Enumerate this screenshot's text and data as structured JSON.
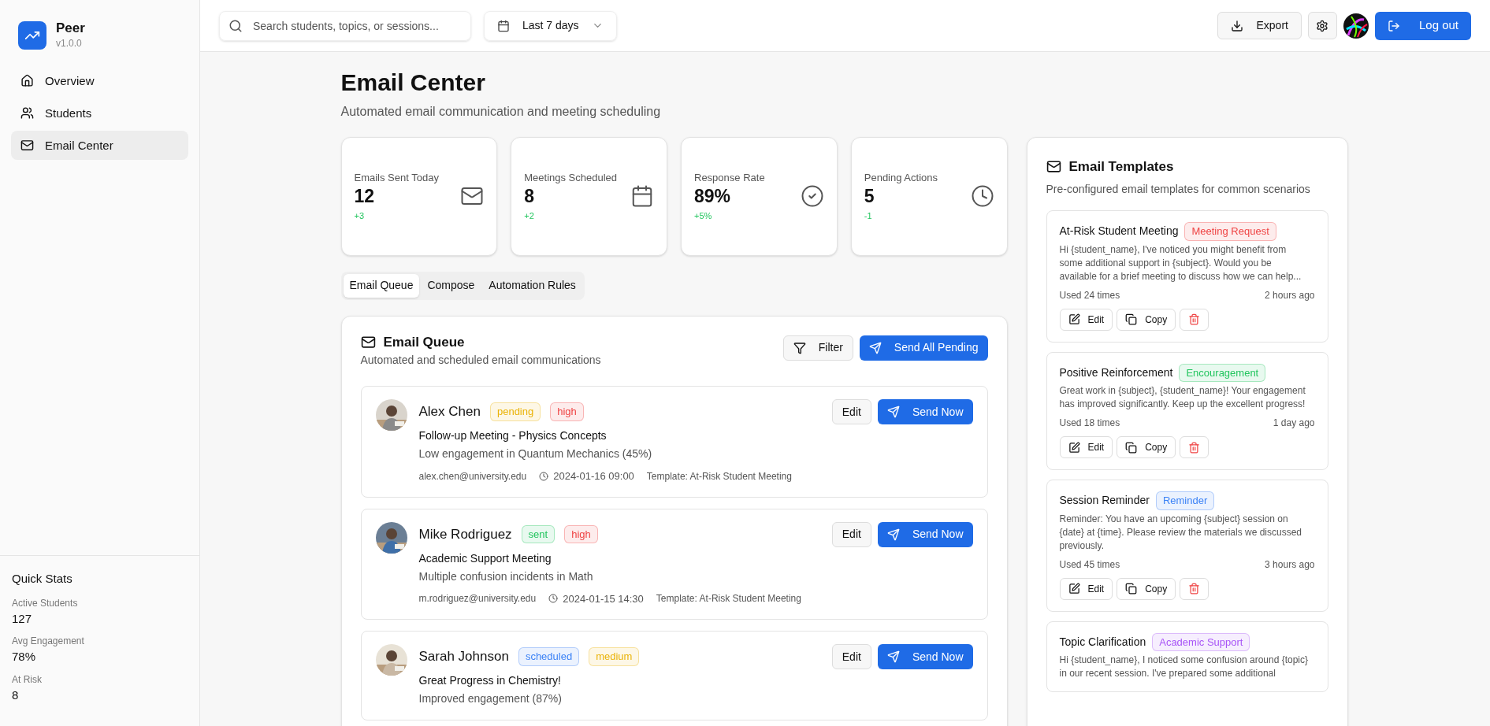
{
  "app": {
    "name": "Peer",
    "version": "v1.0.0"
  },
  "nav": [
    {
      "label": "Overview",
      "selected": false
    },
    {
      "label": "Students",
      "selected": false
    },
    {
      "label": "Email Center",
      "selected": true
    }
  ],
  "quick_stats": {
    "title": "Quick Stats",
    "items": [
      {
        "label": "Active Students",
        "value": "127"
      },
      {
        "label": "Avg Engagement",
        "value": "78%"
      },
      {
        "label": "At Risk",
        "value": "8"
      }
    ]
  },
  "header": {
    "search": {
      "placeholder": "Search students, topics, or sessions..."
    },
    "range": "Last 7 days",
    "export": "Export",
    "logout": "Log out"
  },
  "page": {
    "title": "Email Center",
    "subtitle": "Automated email communication and meeting scheduling"
  },
  "stats": [
    {
      "label": "Emails Sent Today",
      "value": "12",
      "change": "+3"
    },
    {
      "label": "Meetings Scheduled",
      "value": "8",
      "change": "+2"
    },
    {
      "label": "Response Rate",
      "value": "89%",
      "change": "+5%"
    },
    {
      "label": "Pending Actions",
      "value": "5",
      "change": "-1"
    }
  ],
  "tabs": [
    {
      "label": "Email Queue",
      "selected": true
    },
    {
      "label": "Compose",
      "selected": false
    },
    {
      "label": "Automation Rules",
      "selected": false
    }
  ],
  "queue": {
    "title": "Email Queue",
    "subtitle": "Automated and scheduled email communications",
    "filter": "Filter",
    "send_all": "Send All Pending",
    "items": [
      {
        "name": "Alex Chen",
        "tags": [
          {
            "label": "pending",
            "color": "#eab308"
          },
          {
            "label": "high",
            "color": "#ef4444"
          }
        ],
        "subject": "Follow-up Meeting - Physics Concepts",
        "reason": "Low engagement in Quantum Mechanics (45%)",
        "email": "alex.chen@university.edu",
        "time": "2024-01-16 09:00",
        "template": "Template: At-Risk Student Meeting",
        "edit": "Edit",
        "send": "Send Now"
      },
      {
        "name": "Mike Rodriguez",
        "tags": [
          {
            "label": "sent",
            "color": "#22c55e"
          },
          {
            "label": "high",
            "color": "#ef4444"
          }
        ],
        "subject": "Academic Support Meeting",
        "reason": "Multiple confusion incidents in Math",
        "email": "m.rodriguez@university.edu",
        "time": "2024-01-15 14:30",
        "template": "Template: At-Risk Student Meeting",
        "edit": "Edit",
        "send": "Send Now"
      },
      {
        "name": "Sarah Johnson",
        "tags": [
          {
            "label": "scheduled",
            "color": "#3b82f6"
          },
          {
            "label": "medium",
            "color": "#eab308"
          }
        ],
        "subject": "Great Progress in Chemistry!",
        "reason": "Improved engagement (87%)",
        "edit": "Edit",
        "send": "Send Now"
      }
    ]
  },
  "templates": {
    "title": "Email Templates",
    "subtitle": "Pre-configured email templates for common scenarios",
    "items": [
      {
        "name": "At-Risk Student Meeting",
        "tag": "Meeting Request",
        "color": "#ef4444",
        "body": "Hi {student_name}, I've noticed you might benefit from some additional support in {subject}. Would you be available for a brief meeting to discuss how we can help...",
        "usage": "Used 24 times",
        "when": "2 hours ago",
        "edit": "Edit",
        "copy": "Copy"
      },
      {
        "name": "Positive Reinforcement",
        "tag": "Encouragement",
        "color": "#22c55e",
        "body": "Great work in {subject}, {student_name}! Your engagement has improved significantly. Keep up the excellent progress!",
        "usage": "Used 18 times",
        "when": "1 day ago",
        "edit": "Edit",
        "copy": "Copy"
      },
      {
        "name": "Session Reminder",
        "tag": "Reminder",
        "color": "#3b82f6",
        "body": "Reminder: You have an upcoming {subject} session on {date} at {time}. Please review the materials we discussed previously.",
        "usage": "Used 45 times",
        "when": "3 hours ago",
        "edit": "Edit",
        "copy": "Copy"
      },
      {
        "name": "Topic Clarification",
        "tag": "Academic Support",
        "color": "#a855f7",
        "body": "Hi {student_name}, I noticed some confusion around {topic} in our recent session. I've prepared some additional"
      }
    ]
  }
}
